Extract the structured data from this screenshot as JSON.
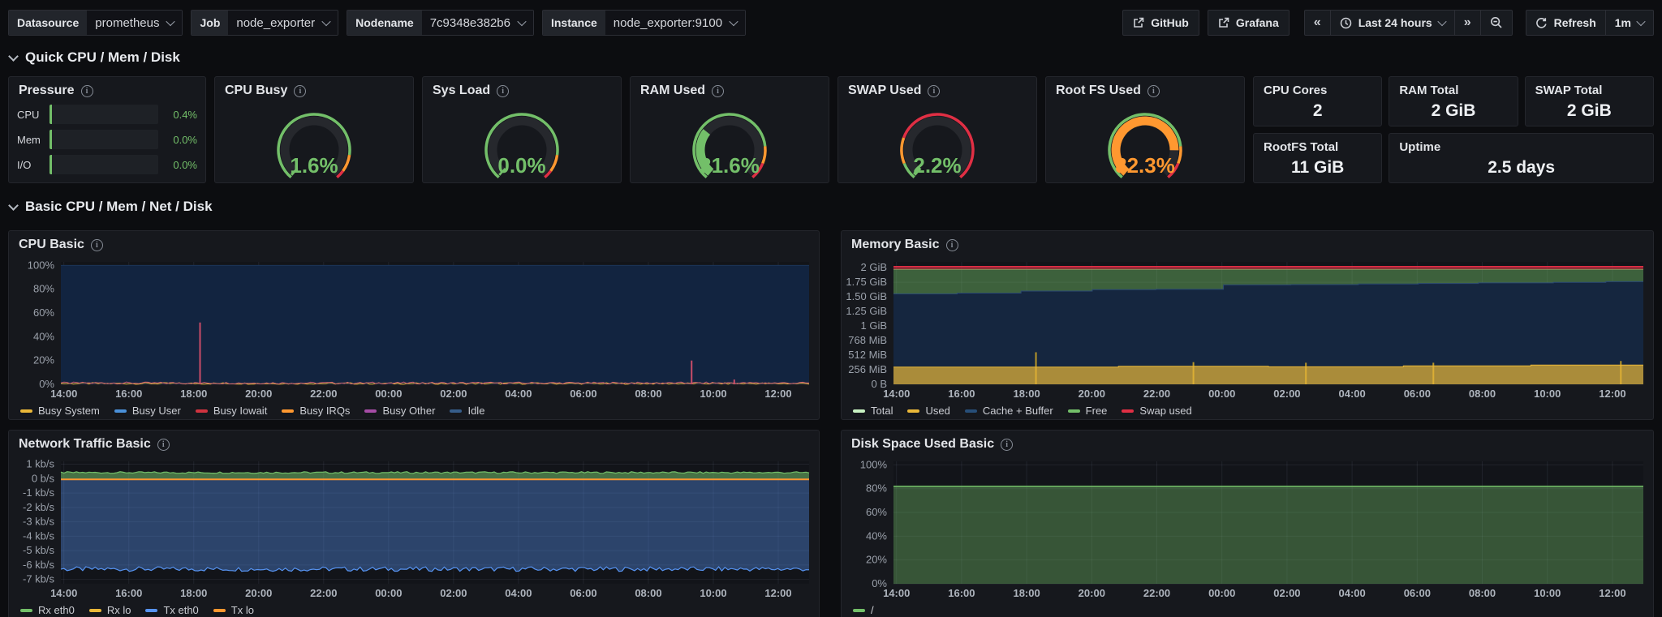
{
  "toolbar": {
    "variables": [
      {
        "label": "Datasource",
        "value": "prometheus"
      },
      {
        "label": "Job",
        "value": "node_exporter"
      },
      {
        "label": "Nodename",
        "value": "7c9348e382b6"
      },
      {
        "label": "Instance",
        "value": "node_exporter:9100"
      }
    ],
    "links": [
      {
        "label": "GitHub"
      },
      {
        "label": "Grafana"
      }
    ],
    "time_back": "«",
    "time_forward": "»",
    "time_range": "Last 24 hours",
    "refresh_label": "Refresh",
    "refresh_interval": "1m"
  },
  "sections": {
    "quick": "Quick CPU / Mem / Disk",
    "basic": "Basic CPU / Mem / Net / Disk"
  },
  "pressure": {
    "title": "Pressure",
    "rows": [
      {
        "label": "CPU",
        "value": "0.4%",
        "pct": 0.4
      },
      {
        "label": "Mem",
        "value": "0.0%",
        "pct": 0.0
      },
      {
        "label": "I/O",
        "value": "0.0%",
        "pct": 0.0
      }
    ]
  },
  "gauges": [
    {
      "title": "CPU Busy",
      "value": 1.6,
      "display": "1.6%",
      "color": "#73bf69",
      "thresholds": [
        [
          0,
          85,
          "#73bf69"
        ],
        [
          85,
          95,
          "#ff9830"
        ],
        [
          95,
          100,
          "#e02f44"
        ]
      ]
    },
    {
      "title": "Sys Load",
      "value": 0.0,
      "display": "0.0%",
      "color": "#73bf69",
      "thresholds": [
        [
          0,
          85,
          "#73bf69"
        ],
        [
          85,
          95,
          "#ff9830"
        ],
        [
          95,
          100,
          "#e02f44"
        ]
      ]
    },
    {
      "title": "RAM Used",
      "value": 31.6,
      "display": "31.6%",
      "color": "#73bf69",
      "thresholds": [
        [
          0,
          80,
          "#73bf69"
        ],
        [
          80,
          90,
          "#ff9830"
        ],
        [
          90,
          100,
          "#e02f44"
        ]
      ]
    },
    {
      "title": "SWAP Used",
      "value": 2.2,
      "display": "2.2%",
      "color": "#73bf69",
      "thresholds": [
        [
          0,
          10,
          "#73bf69"
        ],
        [
          10,
          25,
          "#ff9830"
        ],
        [
          25,
          100,
          "#e02f44"
        ]
      ]
    },
    {
      "title": "Root FS Used",
      "value": 82.3,
      "display": "82.3%",
      "color": "#ff9830",
      "thresholds": [
        [
          0,
          80,
          "#73bf69"
        ],
        [
          80,
          90,
          "#ff9830"
        ],
        [
          90,
          100,
          "#e02f44"
        ]
      ]
    }
  ],
  "stats": [
    {
      "title": "CPU Cores",
      "value": "2",
      "wide": false
    },
    {
      "title": "RAM Total",
      "value": "2 GiB",
      "wide": false
    },
    {
      "title": "SWAP Total",
      "value": "2 GiB",
      "wide": false
    },
    {
      "title": "RootFS Total",
      "value": "11 GiB",
      "wide": false
    },
    {
      "title": "Uptime",
      "value": "2.5 days",
      "wide": true
    }
  ],
  "chart_data": [
    {
      "type": "area",
      "title": "CPU Basic",
      "x_ticks": [
        "14:00",
        "16:00",
        "18:00",
        "20:00",
        "22:00",
        "00:00",
        "02:00",
        "04:00",
        "06:00",
        "08:00",
        "10:00",
        "12:00"
      ],
      "ylim": [
        0,
        103
      ],
      "y_ticks": [
        {
          "v": 100,
          "label": "100%"
        },
        {
          "v": 80,
          "label": "80%"
        },
        {
          "v": 60,
          "label": "60%"
        },
        {
          "v": 40,
          "label": "40%"
        },
        {
          "v": 20,
          "label": "20%"
        },
        {
          "v": 0,
          "label": "0%"
        }
      ],
      "legend": [
        {
          "name": "Busy System",
          "color": "#eab839"
        },
        {
          "name": "Busy User",
          "color": "#4a90d9"
        },
        {
          "name": "Busy Iowait",
          "color": "#d0333f"
        },
        {
          "name": "Busy IRQs",
          "color": "#ff9830"
        },
        {
          "name": "Busy Other",
          "color": "#a64ca6"
        },
        {
          "name": "Idle",
          "color": "#365d8a"
        }
      ],
      "series": [
        {
          "kind": "area",
          "points": [
            [
              0,
              100
            ],
            [
              1,
              100
            ]
          ],
          "baseline": 0,
          "fill": "#122440",
          "line": "#1c3558",
          "width": 1
        },
        {
          "kind": "noise-line",
          "base": 0.7,
          "amp": 0.7,
          "seed": 3,
          "color": "#eab839",
          "width": 1
        },
        {
          "kind": "noise-line",
          "base": 1.1,
          "amp": 0.8,
          "seed": 9,
          "color": "#c75d72",
          "width": 1
        },
        {
          "kind": "spikes",
          "points": [
            [
              0.186,
              52
            ],
            [
              0.843,
              20
            ],
            [
              0.9,
              4
            ]
          ],
          "color": "#c94c68",
          "width": 2
        }
      ]
    },
    {
      "type": "area",
      "title": "Memory Basic",
      "x_ticks": [
        "14:00",
        "16:00",
        "18:00",
        "20:00",
        "22:00",
        "00:00",
        "02:00",
        "04:00",
        "06:00",
        "08:00",
        "10:00",
        "12:00"
      ],
      "ylim": [
        0,
        2.1
      ],
      "y_ticks": [
        {
          "v": 2,
          "label": "2 GiB"
        },
        {
          "v": 1.75,
          "label": "1.75 GiB"
        },
        {
          "v": 1.5,
          "label": "1.50 GiB"
        },
        {
          "v": 1.25,
          "label": "1.25 GiB"
        },
        {
          "v": 1,
          "label": "1 GiB"
        },
        {
          "v": 0.75,
          "label": "768 MiB"
        },
        {
          "v": 0.5,
          "label": "512 MiB"
        },
        {
          "v": 0.25,
          "label": "256 MiB"
        },
        {
          "v": 0,
          "label": "0 B"
        }
      ],
      "legend": [
        {
          "name": "Total",
          "color": "#c8f2c2"
        },
        {
          "name": "Used",
          "color": "#eab839"
        },
        {
          "name": "Cache + Buffer",
          "color": "#274e78"
        },
        {
          "name": "Free",
          "color": "#73bf69"
        },
        {
          "name": "Swap used",
          "color": "#e02f44"
        }
      ],
      "series": [
        {
          "kind": "area",
          "points": [
            [
              0,
              1.97
            ],
            [
              1,
              1.97
            ]
          ],
          "baseline": 0,
          "fill": "rgba(115,191,105,0.45)",
          "line": "#73bf69",
          "width": 1
        },
        {
          "kind": "area",
          "baseline": 0,
          "fill": "#15263f",
          "line": "#2b4a73",
          "width": 1,
          "points": [
            [
              0,
              1.55
            ],
            [
              0.085,
              1.55
            ],
            [
              0.085,
              1.565
            ],
            [
              0.17,
              1.565
            ],
            [
              0.17,
              1.6
            ],
            [
              0.265,
              1.6
            ],
            [
              0.265,
              1.625
            ],
            [
              0.35,
              1.625
            ],
            [
              0.35,
              1.63
            ],
            [
              0.44,
              1.63
            ],
            [
              0.44,
              1.705
            ],
            [
              0.53,
              1.705
            ],
            [
              0.53,
              1.71
            ],
            [
              0.62,
              1.71
            ],
            [
              0.62,
              1.72
            ],
            [
              0.7,
              1.72
            ],
            [
              0.7,
              1.73
            ],
            [
              0.78,
              1.73
            ],
            [
              0.78,
              1.74
            ],
            [
              0.88,
              1.74
            ],
            [
              0.88,
              1.75
            ],
            [
              0.95,
              1.75
            ],
            [
              0.95,
              1.76
            ],
            [
              1,
              1.76
            ]
          ]
        },
        {
          "kind": "spikes",
          "points": [
            [
              0.19,
              0.55
            ],
            [
              0.4,
              0.38
            ],
            [
              0.55,
              0.37
            ],
            [
              0.72,
              0.37
            ],
            [
              0.97,
              0.4
            ]
          ],
          "color": "#b89729",
          "width": 2
        },
        {
          "kind": "area",
          "baseline": 0,
          "fill": "rgba(234,184,57,0.7)",
          "line": "#eab839",
          "width": 1,
          "points": [
            [
              0,
              0.295
            ],
            [
              0.3,
              0.295
            ],
            [
              0.3,
              0.31
            ],
            [
              0.5,
              0.31
            ],
            [
              0.5,
              0.3
            ],
            [
              0.68,
              0.3
            ],
            [
              0.68,
              0.315
            ],
            [
              0.85,
              0.315
            ],
            [
              0.85,
              0.33
            ],
            [
              1,
              0.33
            ]
          ]
        },
        {
          "kind": "area",
          "points": [
            [
              0,
              2.02
            ],
            [
              1,
              2.02
            ]
          ],
          "baseline": 1.97,
          "fill": "rgba(224,47,68,0.55)",
          "line": "#e02f44",
          "width": 1.5
        }
      ]
    },
    {
      "type": "area",
      "title": "Network Traffic Basic",
      "x_ticks": [
        "14:00",
        "16:00",
        "18:00",
        "20:00",
        "22:00",
        "00:00",
        "02:00",
        "04:00",
        "06:00",
        "08:00",
        "10:00",
        "12:00"
      ],
      "ylim": [
        -7.3,
        1.2
      ],
      "y_ticks": [
        {
          "v": 1,
          "label": "1 kb/s"
        },
        {
          "v": 0,
          "label": "0 b/s"
        },
        {
          "v": -1,
          "label": "-1 kb/s"
        },
        {
          "v": -2,
          "label": "-2 kb/s"
        },
        {
          "v": -3,
          "label": "-3 kb/s"
        },
        {
          "v": -4,
          "label": "-4 kb/s"
        },
        {
          "v": -5,
          "label": "-5 kb/s"
        },
        {
          "v": -6,
          "label": "-6 kb/s"
        },
        {
          "v": -7,
          "label": "-7 kb/s"
        }
      ],
      "legend": [
        {
          "name": "Rx eth0",
          "color": "#73bf69"
        },
        {
          "name": "Rx lo",
          "color": "#eab839"
        },
        {
          "name": "Tx eth0",
          "color": "#5794f2"
        },
        {
          "name": "Tx lo",
          "color": "#ff9830"
        }
      ],
      "series": [
        {
          "kind": "noise-area",
          "base": -6.28,
          "amp": 0.16,
          "seed": 5,
          "baseline": 0,
          "fill": "rgba(87,148,242,0.38)",
          "color": "#5794f2",
          "width": 1.2
        },
        {
          "kind": "noise-area",
          "base": 0.42,
          "amp": 0.06,
          "seed": 11,
          "baseline": 0,
          "fill": "rgba(115,191,105,0.55)",
          "color": "#73bf69",
          "width": 1.2
        },
        {
          "kind": "area",
          "points": [
            [
              0,
              -0.05
            ],
            [
              1,
              -0.05
            ]
          ],
          "baseline": -0.05,
          "fill": "none",
          "line": "#ff9830",
          "width": 2
        }
      ]
    },
    {
      "type": "area",
      "title": "Disk Space Used Basic",
      "x_ticks": [
        "14:00",
        "16:00",
        "18:00",
        "20:00",
        "22:00",
        "00:00",
        "02:00",
        "04:00",
        "06:00",
        "08:00",
        "10:00",
        "12:00"
      ],
      "ylim": [
        0,
        103
      ],
      "y_ticks": [
        {
          "v": 100,
          "label": "100%"
        },
        {
          "v": 80,
          "label": "80%"
        },
        {
          "v": 60,
          "label": "60%"
        },
        {
          "v": 40,
          "label": "40%"
        },
        {
          "v": 20,
          "label": "20%"
        },
        {
          "v": 0,
          "label": "0%"
        }
      ],
      "legend": [
        {
          "name": "/",
          "color": "#73bf69"
        }
      ],
      "series": [
        {
          "kind": "area",
          "points": [
            [
              0,
              82
            ],
            [
              1,
              82
            ]
          ],
          "baseline": 0,
          "fill": "rgba(115,191,105,0.38)",
          "line": "#73bf69",
          "width": 1.5
        }
      ]
    }
  ]
}
